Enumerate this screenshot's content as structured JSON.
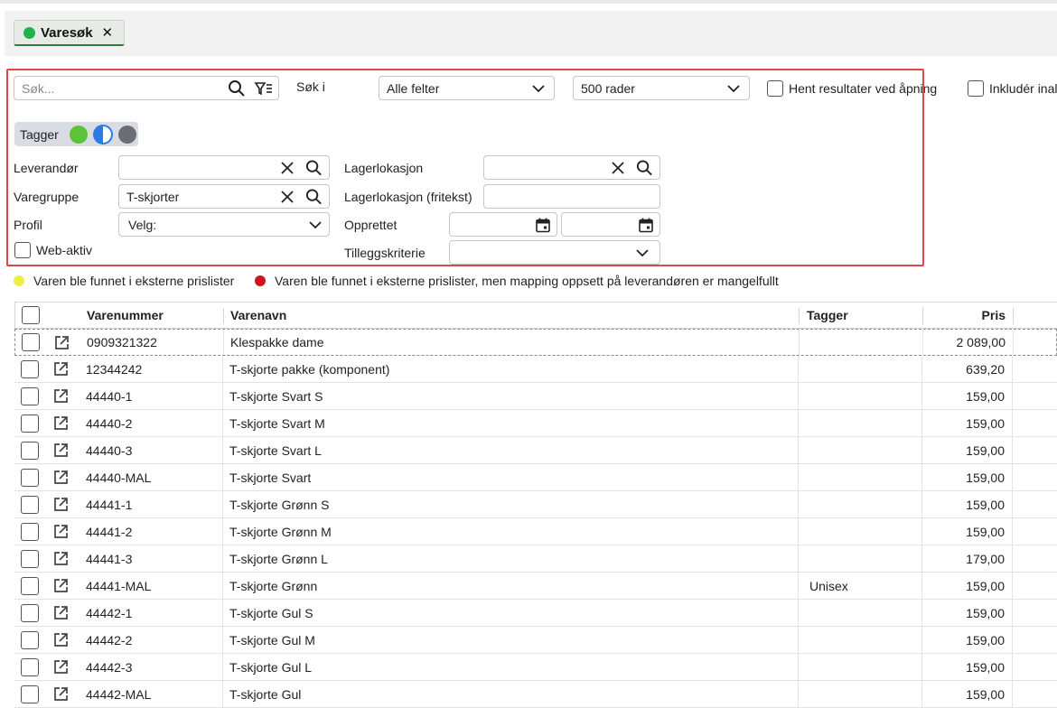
{
  "tab": {
    "label": "Varesøk",
    "close": "✕",
    "dot_color": "#22b14c"
  },
  "search": {
    "placeholder": "Søk...",
    "sok_i_label": "Søk i",
    "field_select": "Alle felter",
    "rows_select": "500 rader",
    "hent_label": "Hent resultater ved åpning",
    "inkluder_label": "Inkludér inal"
  },
  "tagger": {
    "label": "Tagger",
    "colors": [
      "#5ec13a",
      "#2d7be5",
      "#6b6e73"
    ]
  },
  "filters": {
    "leverandor_label": "Leverandør",
    "leverandor_value": "",
    "varegruppe_label": "Varegruppe",
    "varegruppe_value": "T-skjorter",
    "profil_label": "Profil",
    "profil_value": "Velg:",
    "webaktiv_label": "Web-aktiv",
    "lagerlokasjon_label": "Lagerlokasjon",
    "lagerlokasjon_fritekst_label": "Lagerlokasjon (fritekst)",
    "opprettet_label": "Opprettet",
    "tilleggskriterie_label": "Tilleggskriterie"
  },
  "legend": {
    "yellow_text": "Varen ble funnet i eksterne prislister",
    "yellow_color": "#ecf045",
    "red_text": "Varen ble funnet i eksterne prislister, men mapping oppsett på leverandøren er mangelfullt",
    "red_color": "#d0121b"
  },
  "table": {
    "headers": {
      "varenummer": "Varenummer",
      "varenavn": "Varenavn",
      "tagger": "Tagger",
      "pris": "Pris"
    },
    "rows": [
      {
        "varenummer": "0909321322",
        "varenavn": "Klespakke dame",
        "tagger": "",
        "pris": "2 089,00"
      },
      {
        "varenummer": "12344242",
        "varenavn": "T-skjorte pakke (komponent)",
        "tagger": "",
        "pris": "639,20"
      },
      {
        "varenummer": "44440-1",
        "varenavn": "T-skjorte Svart S",
        "tagger": "",
        "pris": "159,00"
      },
      {
        "varenummer": "44440-2",
        "varenavn": "T-skjorte Svart M",
        "tagger": "",
        "pris": "159,00"
      },
      {
        "varenummer": "44440-3",
        "varenavn": "T-skjorte Svart L",
        "tagger": "",
        "pris": "159,00"
      },
      {
        "varenummer": "44440-MAL",
        "varenavn": "T-skjorte Svart",
        "tagger": "",
        "pris": "159,00"
      },
      {
        "varenummer": "44441-1",
        "varenavn": "T-skjorte Grønn S",
        "tagger": "",
        "pris": "159,00"
      },
      {
        "varenummer": "44441-2",
        "varenavn": "T-skjorte Grønn M",
        "tagger": "",
        "pris": "159,00"
      },
      {
        "varenummer": "44441-3",
        "varenavn": "T-skjorte Grønn L",
        "tagger": "",
        "pris": "179,00"
      },
      {
        "varenummer": "44441-MAL",
        "varenavn": "T-skjorte Grønn",
        "tagger": "Unisex",
        "pris": "159,00"
      },
      {
        "varenummer": "44442-1",
        "varenavn": "T-skjorte Gul S",
        "tagger": "",
        "pris": "159,00"
      },
      {
        "varenummer": "44442-2",
        "varenavn": "T-skjorte Gul M",
        "tagger": "",
        "pris": "159,00"
      },
      {
        "varenummer": "44442-3",
        "varenavn": "T-skjorte Gul L",
        "tagger": "",
        "pris": "159,00"
      },
      {
        "varenummer": "44442-MAL",
        "varenavn": "T-skjorte Gul",
        "tagger": "",
        "pris": "159,00"
      }
    ]
  }
}
